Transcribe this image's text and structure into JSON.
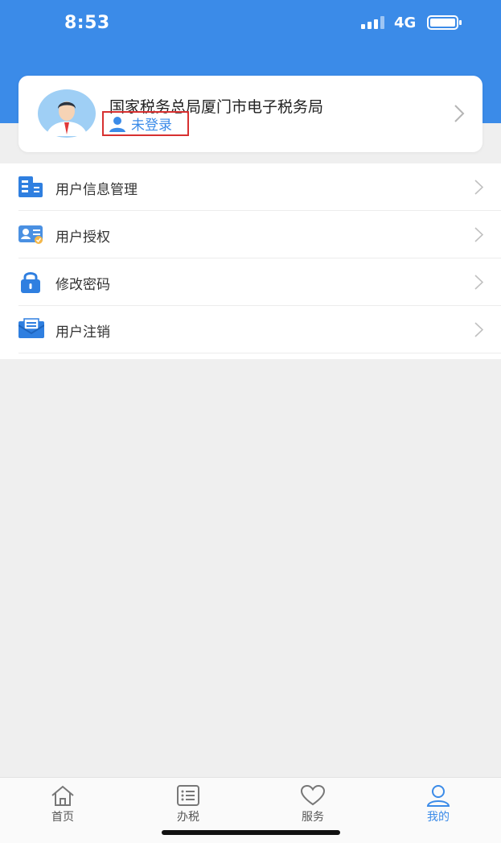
{
  "status_bar": {
    "time": "8:53",
    "network": "4G"
  },
  "profile": {
    "org_name": "国家税务总局厦门市电子税务局",
    "login_status": "未登录"
  },
  "menu": {
    "items": [
      {
        "label": "用户信息管理",
        "icon": "user-info-icon"
      },
      {
        "label": "用户授权",
        "icon": "id-card-icon"
      },
      {
        "label": "修改密码",
        "icon": "lock-icon"
      },
      {
        "label": "用户注销",
        "icon": "envelope-icon"
      }
    ]
  },
  "tabbar": {
    "tabs": [
      {
        "label": "首页",
        "icon": "home-icon"
      },
      {
        "label": "办税",
        "icon": "list-icon"
      },
      {
        "label": "服务",
        "icon": "heart-icon"
      },
      {
        "label": "我的",
        "icon": "person-icon",
        "active": true
      }
    ]
  },
  "colors": {
    "brand": "#3b8be8",
    "highlight_border": "#d73030",
    "background": "#efefef"
  }
}
